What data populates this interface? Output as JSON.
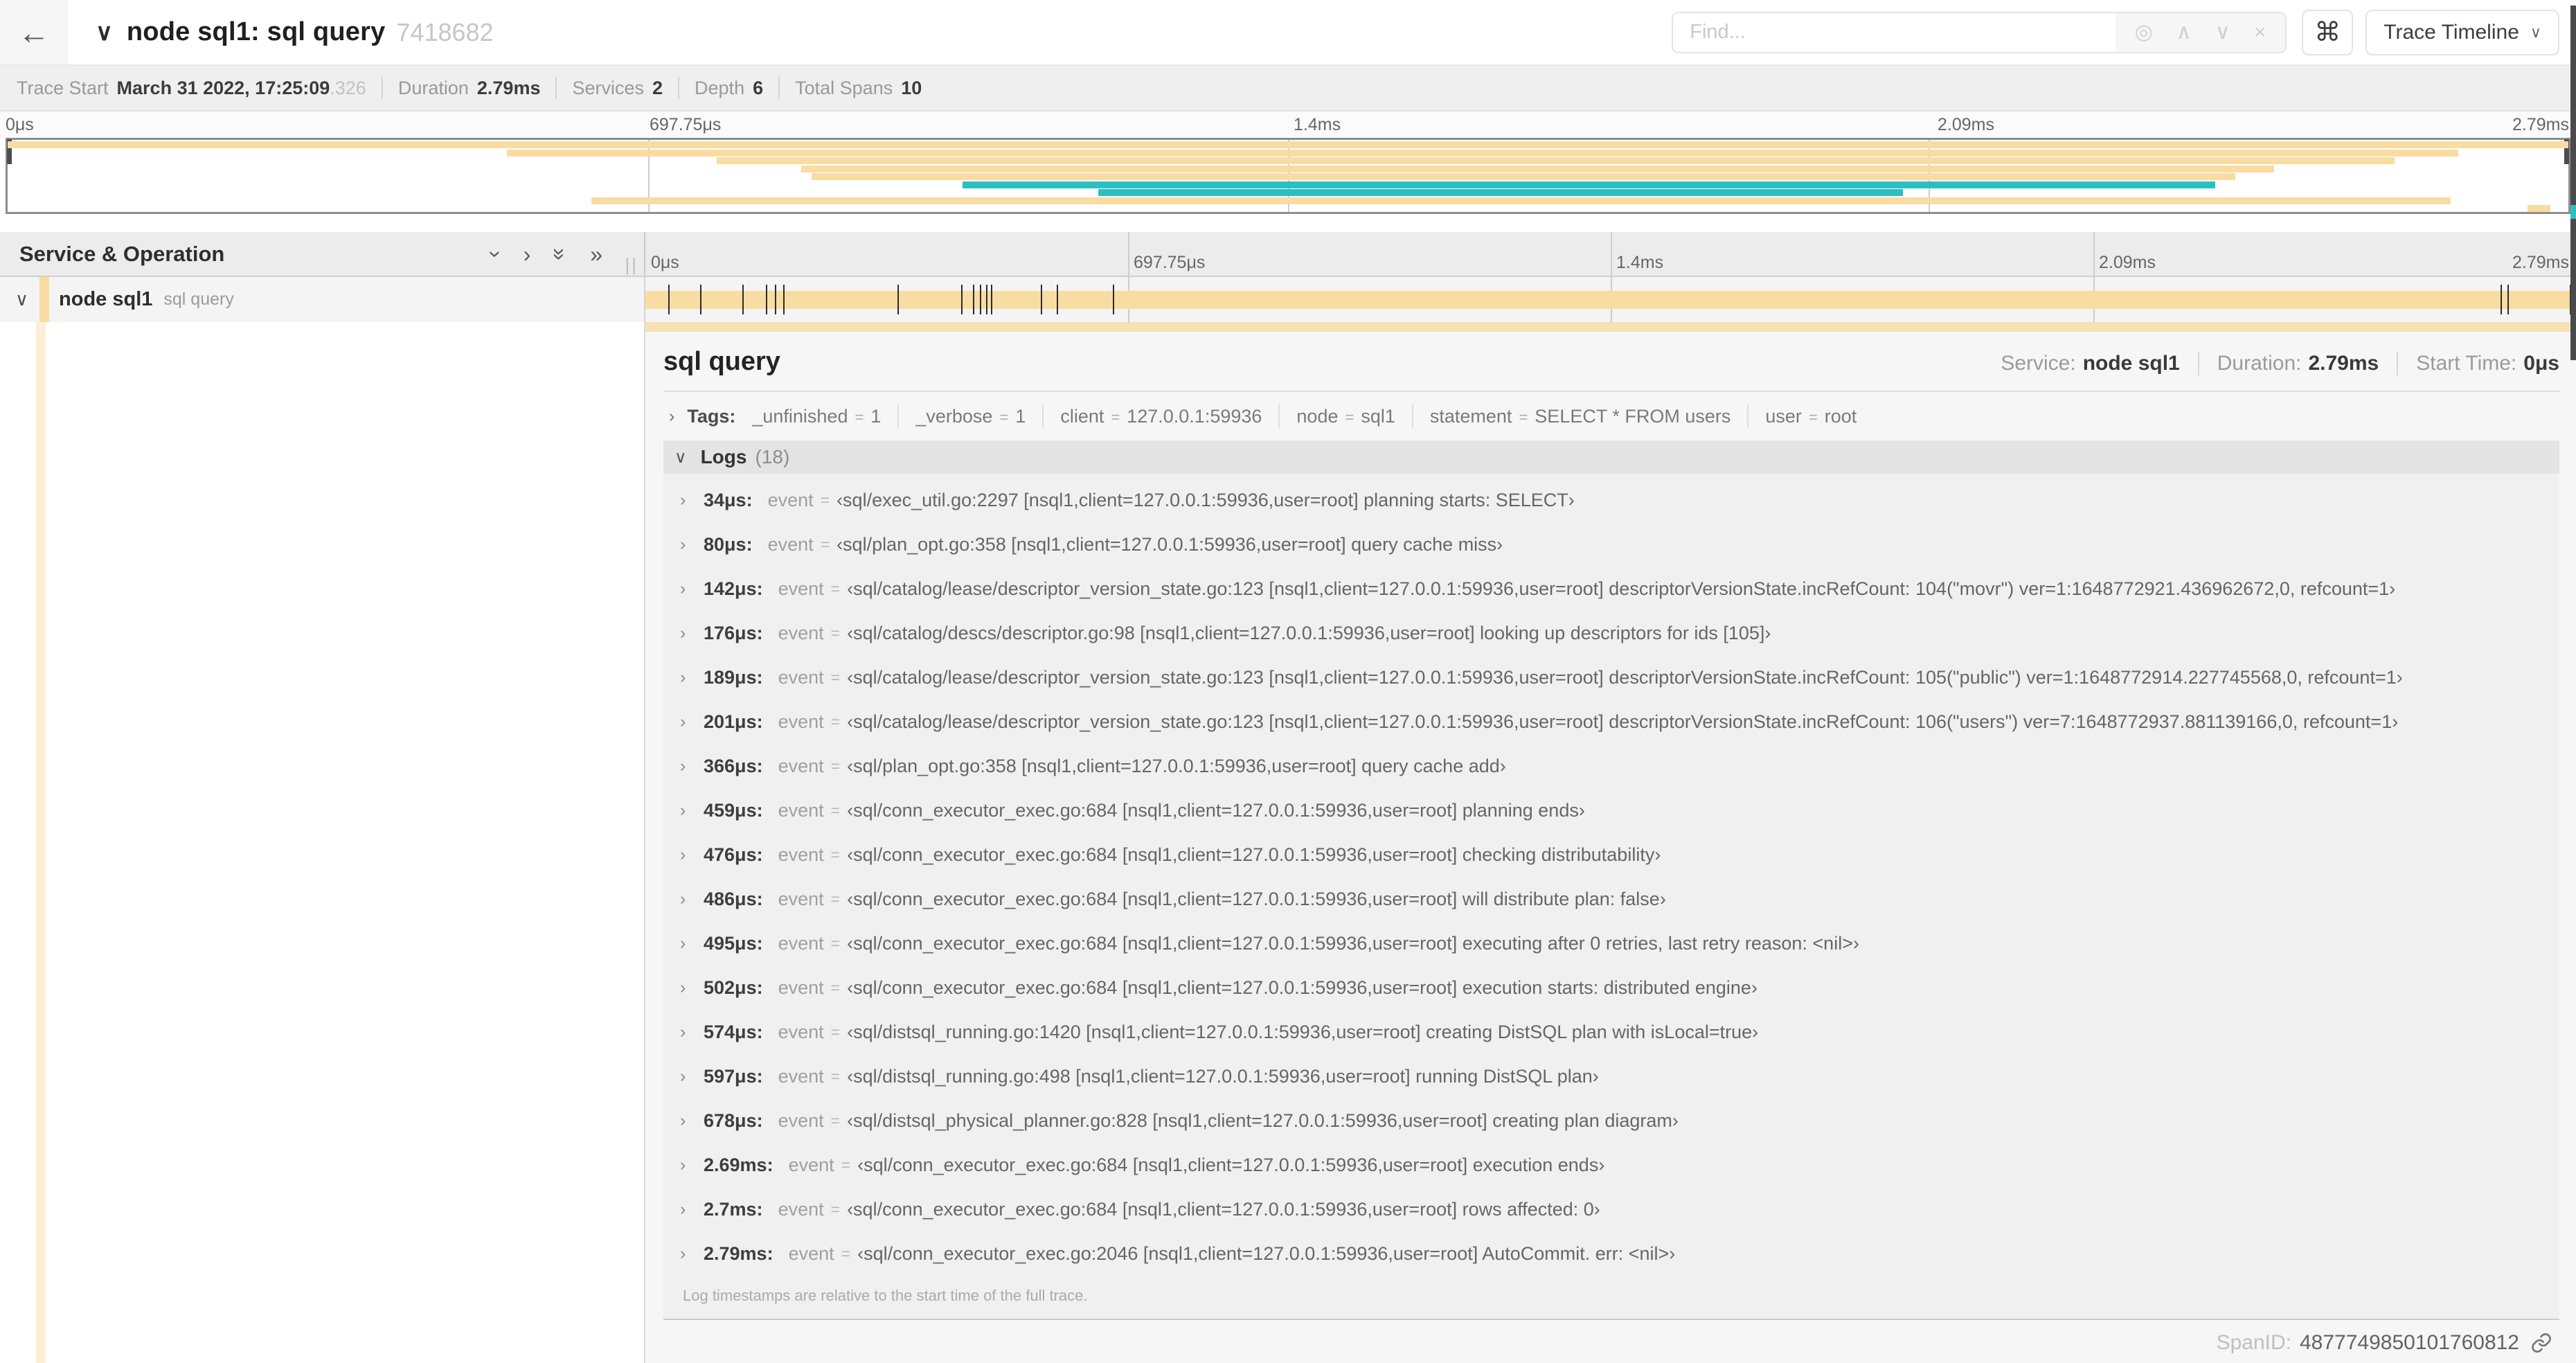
{
  "header": {
    "back_icon": "←",
    "title": "node sql1: sql query",
    "trace_id_short": "7418682",
    "find_placeholder": "Find...",
    "keyboard_shortcut_icon": "⌘",
    "view_dropdown_label": "Trace Timeline"
  },
  "summary": {
    "items": [
      {
        "label": "Trace Start",
        "value": "March 31 2022, 17:25:09",
        "suffix": ".326"
      },
      {
        "label": "Duration",
        "value": "2.79ms",
        "suffix": ""
      },
      {
        "label": "Services",
        "value": "2",
        "suffix": ""
      },
      {
        "label": "Depth",
        "value": "6",
        "suffix": ""
      },
      {
        "label": "Total Spans",
        "value": "10",
        "suffix": ""
      }
    ]
  },
  "colors": {
    "tan": "#F8DCA1",
    "teal": "#2BBFC2",
    "accent_strip": "rgba(248,220,161,0.45)",
    "accent_bar": "rgba(248,220,161,0.8)"
  },
  "minimap": {
    "bars": [
      {
        "row": 0,
        "start": 0.0,
        "end": 100.0,
        "color": "tan"
      },
      {
        "row": 1,
        "start": 19.5,
        "end": 95.7,
        "color": "tan"
      },
      {
        "row": 2,
        "start": 27.7,
        "end": 93.2,
        "color": "tan"
      },
      {
        "row": 3,
        "start": 31.0,
        "end": 88.5,
        "color": "tan"
      },
      {
        "row": 4,
        "start": 31.4,
        "end": 87.0,
        "color": "tan"
      },
      {
        "row": 5,
        "start": 37.3,
        "end": 86.2,
        "color": "teal"
      },
      {
        "row": 6,
        "start": 42.6,
        "end": 74.0,
        "color": "teal"
      },
      {
        "row": 7,
        "start": 22.8,
        "end": 95.4,
        "color": "tan"
      },
      {
        "row": 8,
        "start": 98.4,
        "end": 99.3,
        "color": "tan"
      }
    ]
  },
  "timeline": {
    "left_header": "Service & Operation",
    "axis_ticks": [
      "0μs",
      "697.75μs",
      "1.4ms",
      "2.09ms",
      "2.79ms"
    ],
    "axis_positions": [
      0,
      25,
      50,
      75,
      100
    ],
    "row": {
      "service": "node sql1",
      "operation": "sql query"
    },
    "tick_times_us": [
      34,
      80,
      142,
      176,
      189,
      201,
      366,
      459,
      476,
      486,
      495,
      502,
      574,
      597,
      678,
      2690,
      2700,
      2790
    ],
    "total_us": 2790
  },
  "detail": {
    "title": "sql query",
    "meta": [
      {
        "label": "Service:",
        "value": "node sql1"
      },
      {
        "label": "Duration:",
        "value": "2.79ms"
      },
      {
        "label": "Start Time:",
        "value": "0μs"
      }
    ],
    "tags_label": "Tags:",
    "tags": [
      {
        "key": "_unfinished",
        "value": "1"
      },
      {
        "key": "_verbose",
        "value": "1"
      },
      {
        "key": "client",
        "value": "127.0.0.1:59936"
      },
      {
        "key": "node",
        "value": "sql1"
      },
      {
        "key": "statement",
        "value": "SELECT * FROM users"
      },
      {
        "key": "user",
        "value": "root"
      }
    ],
    "logs_label": "Logs",
    "logs_count": "(18)",
    "logs": [
      {
        "time": "34μs:",
        "field": "event",
        "value": "‹sql/exec_util.go:2297 [nsql1,client=127.0.0.1:59936,user=root] planning starts: SELECT›"
      },
      {
        "time": "80μs:",
        "field": "event",
        "value": "‹sql/plan_opt.go:358 [nsql1,client=127.0.0.1:59936,user=root] query cache miss›"
      },
      {
        "time": "142μs:",
        "field": "event",
        "value": "‹sql/catalog/lease/descriptor_version_state.go:123 [nsql1,client=127.0.0.1:59936,user=root] descriptorVersionState.incRefCount: 104(\"movr\") ver=1:1648772921.436962672,0, refcount=1›"
      },
      {
        "time": "176μs:",
        "field": "event",
        "value": "‹sql/catalog/descs/descriptor.go:98 [nsql1,client=127.0.0.1:59936,user=root] looking up descriptors for ids [105]›"
      },
      {
        "time": "189μs:",
        "field": "event",
        "value": "‹sql/catalog/lease/descriptor_version_state.go:123 [nsql1,client=127.0.0.1:59936,user=root] descriptorVersionState.incRefCount: 105(\"public\") ver=1:1648772914.227745568,0, refcount=1›"
      },
      {
        "time": "201μs:",
        "field": "event",
        "value": "‹sql/catalog/lease/descriptor_version_state.go:123 [nsql1,client=127.0.0.1:59936,user=root] descriptorVersionState.incRefCount: 106(\"users\") ver=7:1648772937.881139166,0, refcount=1›"
      },
      {
        "time": "366μs:",
        "field": "event",
        "value": "‹sql/plan_opt.go:358 [nsql1,client=127.0.0.1:59936,user=root] query cache add›"
      },
      {
        "time": "459μs:",
        "field": "event",
        "value": "‹sql/conn_executor_exec.go:684 [nsql1,client=127.0.0.1:59936,user=root] planning ends›"
      },
      {
        "time": "476μs:",
        "field": "event",
        "value": "‹sql/conn_executor_exec.go:684 [nsql1,client=127.0.0.1:59936,user=root] checking distributability›"
      },
      {
        "time": "486μs:",
        "field": "event",
        "value": "‹sql/conn_executor_exec.go:684 [nsql1,client=127.0.0.1:59936,user=root] will distribute plan: false›"
      },
      {
        "time": "495μs:",
        "field": "event",
        "value": "‹sql/conn_executor_exec.go:684 [nsql1,client=127.0.0.1:59936,user=root] executing after 0 retries, last retry reason: <nil>›"
      },
      {
        "time": "502μs:",
        "field": "event",
        "value": "‹sql/conn_executor_exec.go:684 [nsql1,client=127.0.0.1:59936,user=root] execution starts: distributed engine›"
      },
      {
        "time": "574μs:",
        "field": "event",
        "value": "‹sql/distsql_running.go:1420 [nsql1,client=127.0.0.1:59936,user=root] creating DistSQL plan with isLocal=true›"
      },
      {
        "time": "597μs:",
        "field": "event",
        "value": "‹sql/distsql_running.go:498 [nsql1,client=127.0.0.1:59936,user=root] running DistSQL plan›"
      },
      {
        "time": "678μs:",
        "field": "event",
        "value": "‹sql/distsql_physical_planner.go:828 [nsql1,client=127.0.0.1:59936,user=root] creating plan diagram›"
      },
      {
        "time": "2.69ms:",
        "field": "event",
        "value": "‹sql/conn_executor_exec.go:684 [nsql1,client=127.0.0.1:59936,user=root] execution ends›"
      },
      {
        "time": "2.7ms:",
        "field": "event",
        "value": "‹sql/conn_executor_exec.go:684 [nsql1,client=127.0.0.1:59936,user=root] rows affected: 0›"
      },
      {
        "time": "2.79ms:",
        "field": "event",
        "value": "‹sql/conn_executor_exec.go:2046 [nsql1,client=127.0.0.1:59936,user=root] AutoCommit. err: <nil>›"
      }
    ],
    "footnote": "Log timestamps are relative to the start time of the full trace.",
    "spanid_label": "SpanID:",
    "spanid": "4877749850101760812"
  }
}
